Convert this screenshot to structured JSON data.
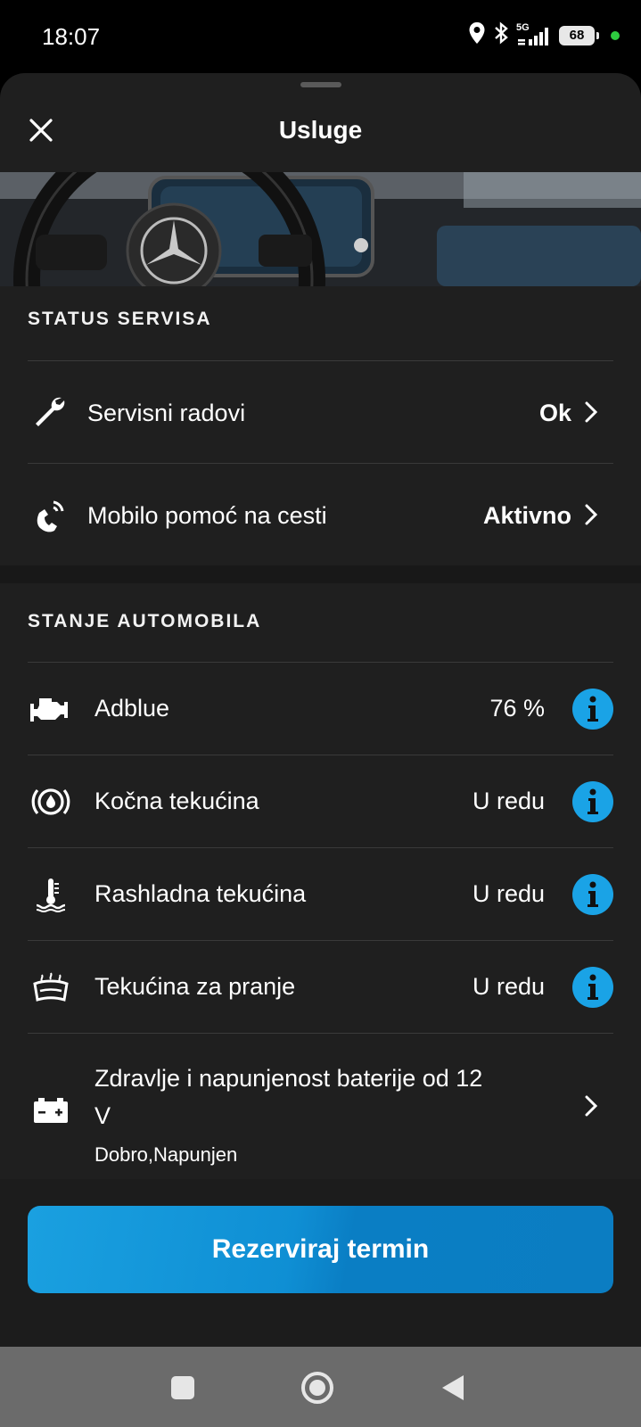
{
  "status_bar": {
    "time": "18:07",
    "network": "5G",
    "battery": "68"
  },
  "header": {
    "title": "Usluge",
    "close_icon": "close-icon"
  },
  "service_status": {
    "title": "STATUS SERVISA",
    "items": [
      {
        "icon": "wrench-icon",
        "label": "Servisni radovi",
        "value": "Ok"
      },
      {
        "icon": "phone-assist-icon",
        "label": "Mobilo pomoć na cesti",
        "value": "Aktivno"
      }
    ]
  },
  "vehicle_status": {
    "title": "STANJE AUTOMOBILA",
    "items": [
      {
        "icon": "engine-icon",
        "label": "Adblue",
        "value": "76 %"
      },
      {
        "icon": "brake-fluid-icon",
        "label": "Kočna tekućina",
        "value": "U redu"
      },
      {
        "icon": "coolant-icon",
        "label": "Rashladna tekućina",
        "value": "U redu"
      },
      {
        "icon": "washer-fluid-icon",
        "label": "Tekućina za pranje",
        "value": "U redu"
      }
    ],
    "battery": {
      "icon": "battery-icon",
      "label_line1": "Zdravlje i napunjenost baterije od 12",
      "label_line2": "V",
      "status": "Dobro,Napunjen"
    }
  },
  "cta": {
    "label": "Rezerviraj termin"
  },
  "colors": {
    "accent": "#1aa3e6",
    "sheet": "#1f1f1f",
    "nav": "#6b6b6b"
  }
}
